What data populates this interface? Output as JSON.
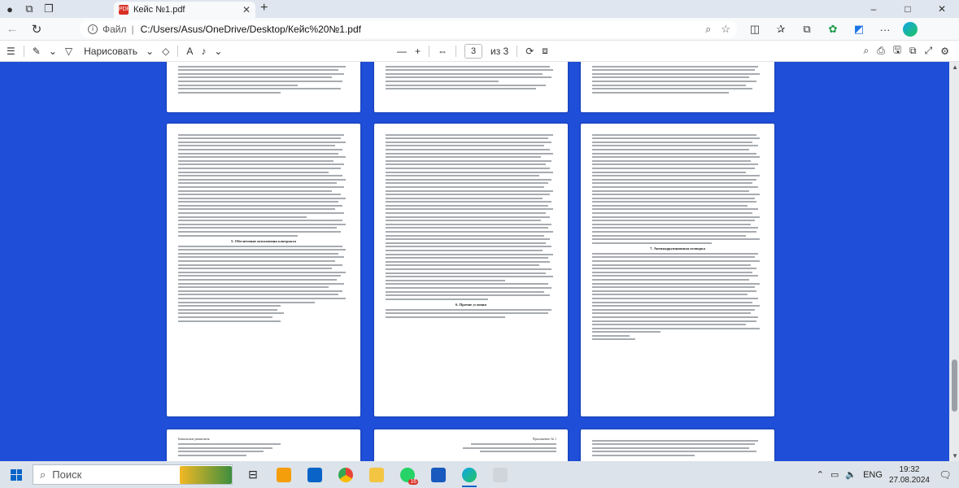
{
  "browser": {
    "tab_title": "Кейс №1.pdf",
    "new_tab_symbol": "+",
    "window_controls": {
      "minimize": "–",
      "maximize": "□",
      "close": "✕"
    },
    "address": {
      "label": "Файл",
      "url": "C:/Users/Asus/OneDrive/Desktop/Кейс%20№1.pdf"
    }
  },
  "pdf_toolbar": {
    "draw_label": "Нарисовать",
    "font_label": "A",
    "minus": "—",
    "plus": "+",
    "page_current": "3",
    "page_total": "из 3"
  },
  "pdf_pages": {
    "section_title_1": "5. Обеспечение исполнения контракта",
    "section_title_2": "6. Прочие условия",
    "section_title_3": "7. Антикоррупционная оговорка",
    "footer_left": "Банковские реквизиты:",
    "footer_mid": "Приложение № 1"
  },
  "taskbar": {
    "search_placeholder": "Поиск",
    "mail_badge": "16",
    "language": "ENG",
    "time": "19:32",
    "date": "27.08.2024"
  },
  "colors": {
    "viewer_bg": "#1f4ed8",
    "pdf_icon": "#d93025",
    "windows_blue": "#0a64c8"
  }
}
